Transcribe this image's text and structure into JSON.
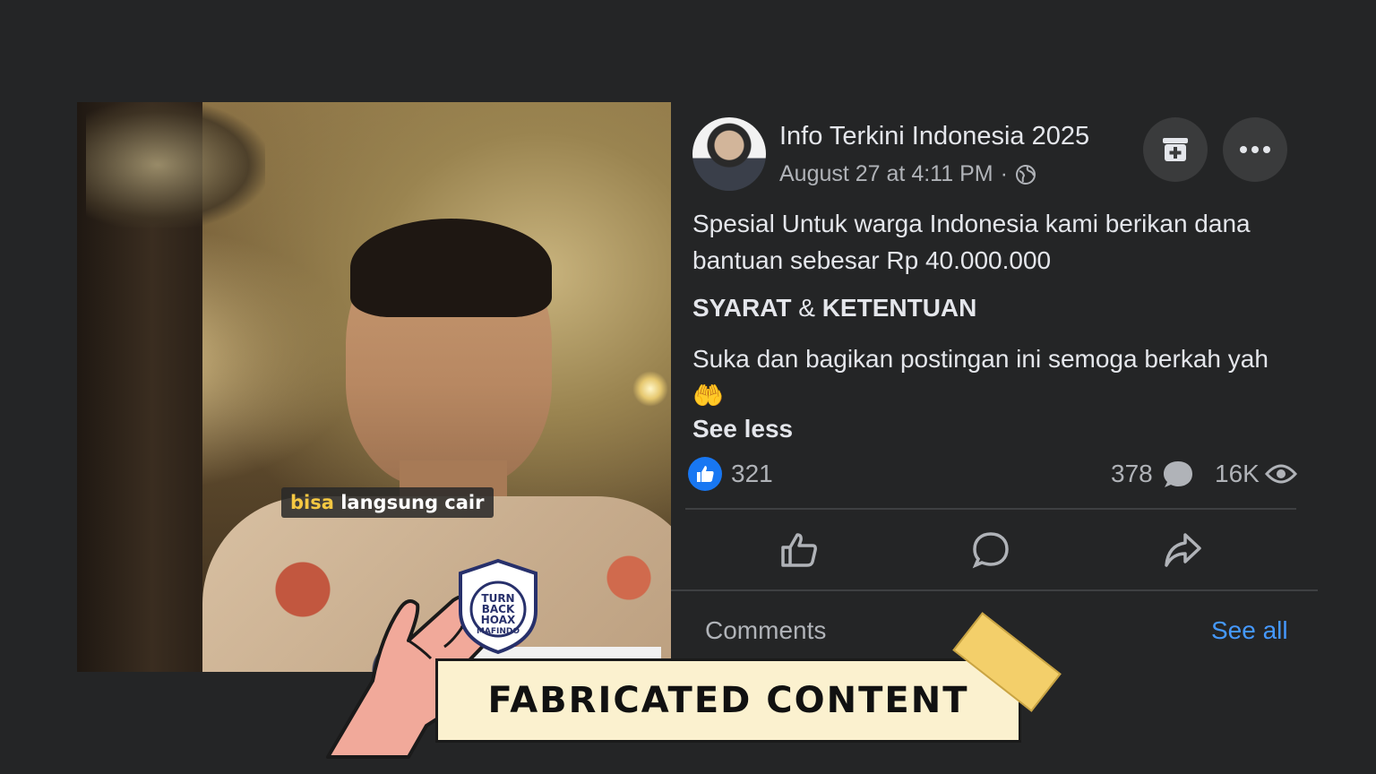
{
  "video": {
    "caption_highlight": "bisa",
    "caption_rest": " langsung cair"
  },
  "post": {
    "page_name": "Info Terkini Indonesia 2025",
    "timestamp": "August 27 at 4:11 PM",
    "separator": "·",
    "body_line1": "Spesial Untuk warga Indonesia kami berikan dana bantuan sebesar Rp 40.000.000",
    "heading_part1": "SYARAT",
    "heading_amp": " & ",
    "heading_part2": "KETENTUAN",
    "body_line2": "Suka dan bagikan postingan ini semoga berkah yah",
    "emoji": "🤲",
    "see_less": "See less",
    "reactions": "321",
    "comments_count": "378",
    "views": "16K",
    "comments_label": "Comments",
    "see_all": "See all"
  },
  "overlay": {
    "label": "FABRICATED CONTENT",
    "badge_top": "TURN BACK",
    "badge_bottom": "HOAX",
    "badge_org": "MAFINDO"
  },
  "colors": {
    "background": "#242526",
    "accent_blue": "#1877f2",
    "link_blue": "#4599ff",
    "banner": "#fbf1cf"
  },
  "icons": [
    "globe-icon",
    "save-icon",
    "more-icon",
    "like-icon",
    "comment-icon",
    "share-icon",
    "eye-icon",
    "thumbs-up-icon"
  ]
}
